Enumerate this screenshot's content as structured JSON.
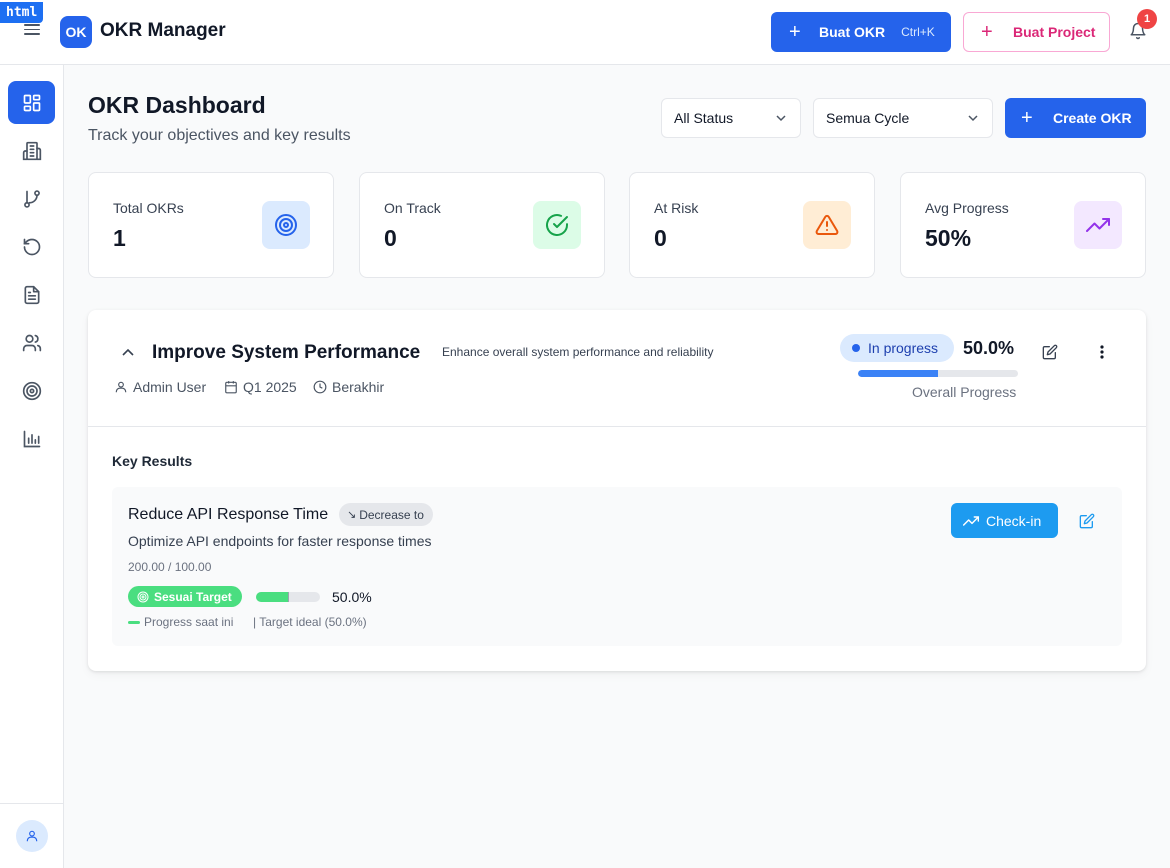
{
  "debug_badge": "html",
  "header": {
    "logo_text": "OK",
    "app_title": "OKR Manager",
    "create_okr_label": "Buat OKR",
    "create_okr_shortcut": "Ctrl+K",
    "create_project_label": "Buat Project",
    "notification_count": "1"
  },
  "sidebar": {
    "items": [
      "dashboard-icon",
      "building-icon",
      "git-branch-icon",
      "history-icon",
      "document-icon",
      "users-icon",
      "target-icon",
      "bar-chart-icon"
    ],
    "active_index": 0
  },
  "page": {
    "title": "OKR Dashboard",
    "subtitle": "Track your objectives and key results",
    "status_filter": "All Status",
    "cycle_filter": "Semua Cycle",
    "create_button": "Create OKR"
  },
  "stats": [
    {
      "label": "Total OKRs",
      "value": "1",
      "icon": "target-icon",
      "color": "#2563eb",
      "bg": "#dbeafe"
    },
    {
      "label": "On Track",
      "value": "0",
      "icon": "check-circle-icon",
      "color": "#16a34a",
      "bg": "#dcfce7"
    },
    {
      "label": "At Risk",
      "value": "0",
      "icon": "warning-icon",
      "color": "#ea580c",
      "bg": "#ffedd5"
    },
    {
      "label": "Avg Progress",
      "value": "50%",
      "icon": "trending-up-icon",
      "color": "#9333ea",
      "bg": "#f3e8ff"
    }
  ],
  "okr": {
    "title": "Improve System Performance",
    "description": "Enhance overall system performance and reliability",
    "owner": "Admin User",
    "cycle": "Q1 2025",
    "time_status": "Berakhir",
    "status": "In progress",
    "progress_label": "50.0%",
    "progress": 0.5,
    "progress_caption": "Overall Progress",
    "key_results_heading": "Key Results",
    "key_results": [
      {
        "title": "Reduce API Response Time",
        "type": "Decrease to",
        "type_arrow": "↘",
        "description": "Optimize API endpoints for faster response times",
        "values": "200.00 / 100.00",
        "status": "Sesuai Target",
        "progress": 0.5,
        "ideal_progress": 0.5,
        "progress_label": "50.0%",
        "legend_current": "Progress saat ini",
        "legend_ideal": "| Target ideal (50.0%)",
        "checkin_label": "Check-in"
      }
    ]
  },
  "colors": {
    "primary": "#2563eb",
    "accent_pink": "#db2777",
    "success": "#4ade80",
    "checkin": "#1d9bf0"
  }
}
